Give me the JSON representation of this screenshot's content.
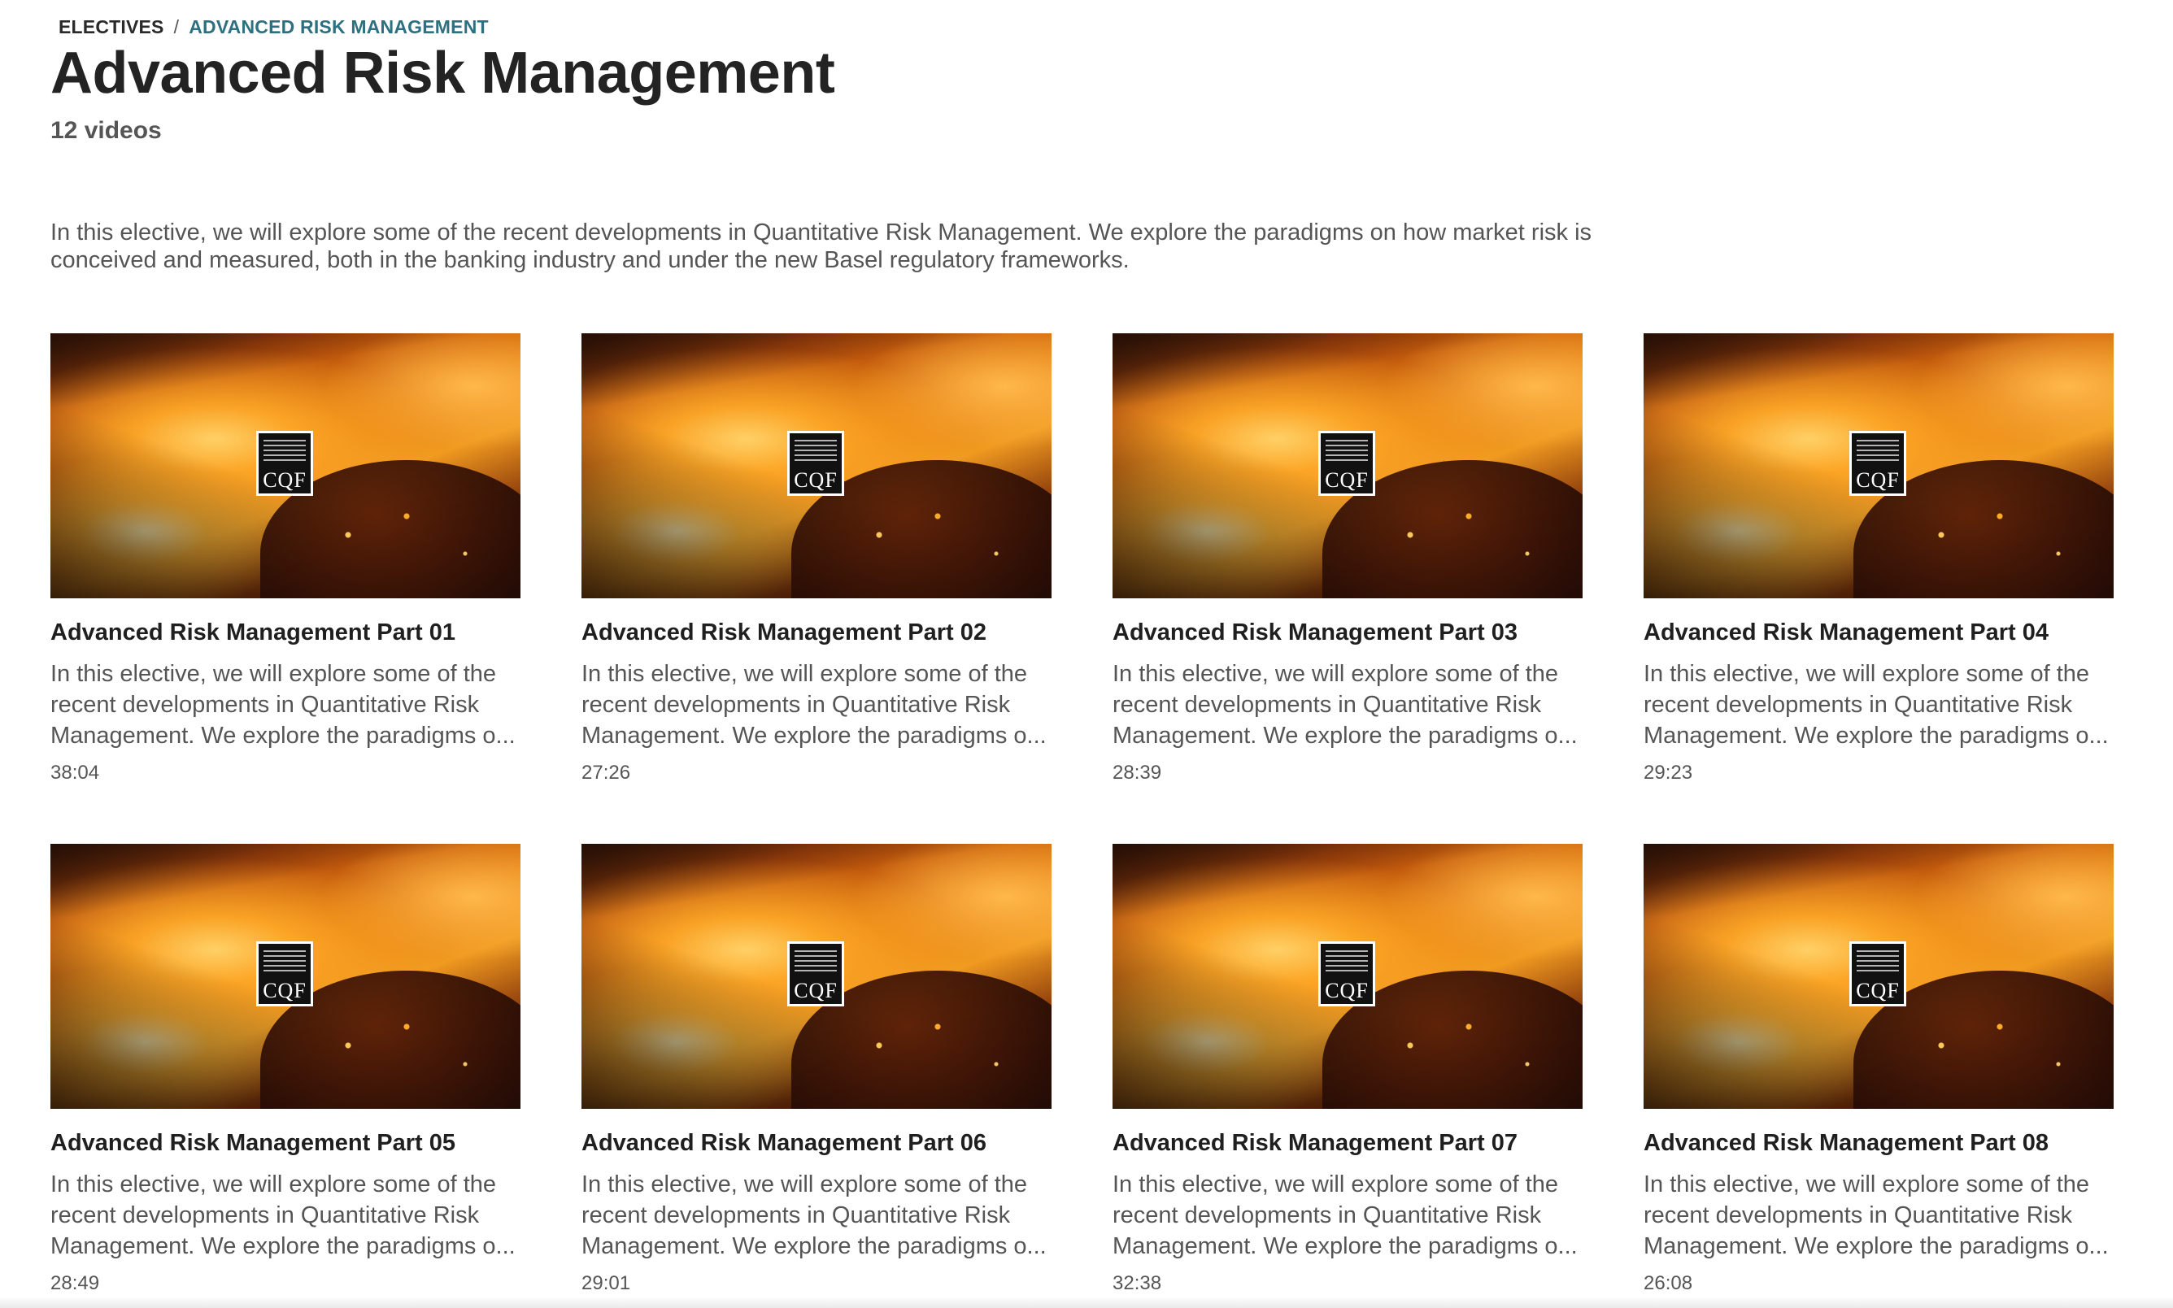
{
  "breadcrumb": {
    "root": "ELECTIVES",
    "separator": "/",
    "current": "ADVANCED RISK MANAGEMENT"
  },
  "title": "Advanced Risk Management",
  "video_count": "12 videos",
  "description": "In this elective, we will explore some of the recent developments in Quantitative Risk Management. We explore the paradigms on how market risk is conceived and measured, both in the banking industry and under the new Basel regulatory frameworks.",
  "colors": {
    "breadcrumb_current": "#2d7080",
    "text_muted": "#555555",
    "title": "#232323"
  },
  "thumbnail_logo_text": "CQF",
  "videos": [
    {
      "title": "Advanced Risk Management Part 01",
      "description": "In this elective, we will explore some of the recent developments in Quantitative Risk Management. We explore the paradigms o...",
      "duration": "38:04"
    },
    {
      "title": "Advanced Risk Management Part 02",
      "description": "In this elective, we will explore some of the recent developments in Quantitative Risk Management. We explore the paradigms o...",
      "duration": "27:26"
    },
    {
      "title": "Advanced Risk Management Part 03",
      "description": "In this elective, we will explore some of the recent developments in Quantitative Risk Management. We explore the paradigms o...",
      "duration": "28:39"
    },
    {
      "title": "Advanced Risk Management Part 04",
      "description": "In this elective, we will explore some of the recent developments in Quantitative Risk Management. We explore the paradigms o...",
      "duration": "29:23"
    },
    {
      "title": "Advanced Risk Management Part 05",
      "description": "In this elective, we will explore some of the recent developments in Quantitative Risk Management. We explore the paradigms o...",
      "duration": "28:49"
    },
    {
      "title": "Advanced Risk Management Part 06",
      "description": "In this elective, we will explore some of the recent developments in Quantitative Risk Management. We explore the paradigms o...",
      "duration": "29:01"
    },
    {
      "title": "Advanced Risk Management Part 07",
      "description": "In this elective, we will explore some of the recent developments in Quantitative Risk Management. We explore the paradigms o...",
      "duration": "32:38"
    },
    {
      "title": "Advanced Risk Management Part 08",
      "description": "In this elective, we will explore some of the recent developments in Quantitative Risk Management. We explore the paradigms o...",
      "duration": "26:08"
    }
  ]
}
